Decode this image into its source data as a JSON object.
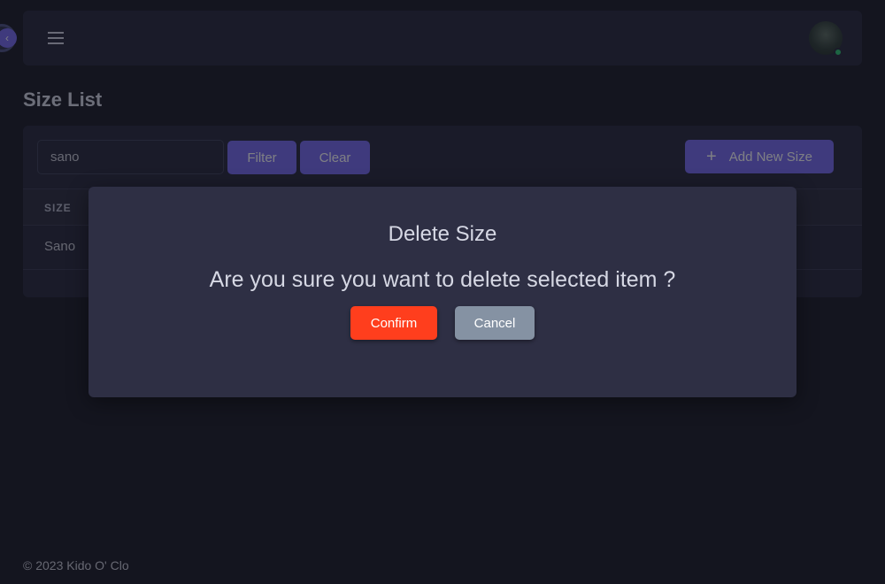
{
  "navbar": {
    "menu_icon": "hamburger-icon",
    "avatar": "user-avatar",
    "status": "online"
  },
  "page": {
    "title": "Size List"
  },
  "filters": {
    "search_value": "sano",
    "filter_label": "Filter",
    "clear_label": "Clear",
    "add_label": "Add New Size",
    "add_icon": "plus-icon"
  },
  "table": {
    "columns": [
      "SIZE"
    ],
    "rows": [
      [
        "Sano"
      ]
    ]
  },
  "footer": {
    "text": "© 2023 Kido O' Clo"
  },
  "modal": {
    "title": "Delete Size",
    "message": "Are you sure you want to delete selected item ?",
    "confirm_label": "Confirm",
    "cancel_label": "Cancel"
  },
  "colors": {
    "primary": "#7367f0",
    "danger": "#ff3e1d",
    "secondary": "#8592a3",
    "background": "#14151f",
    "card": "#222436",
    "modal": "#2e2f44"
  }
}
